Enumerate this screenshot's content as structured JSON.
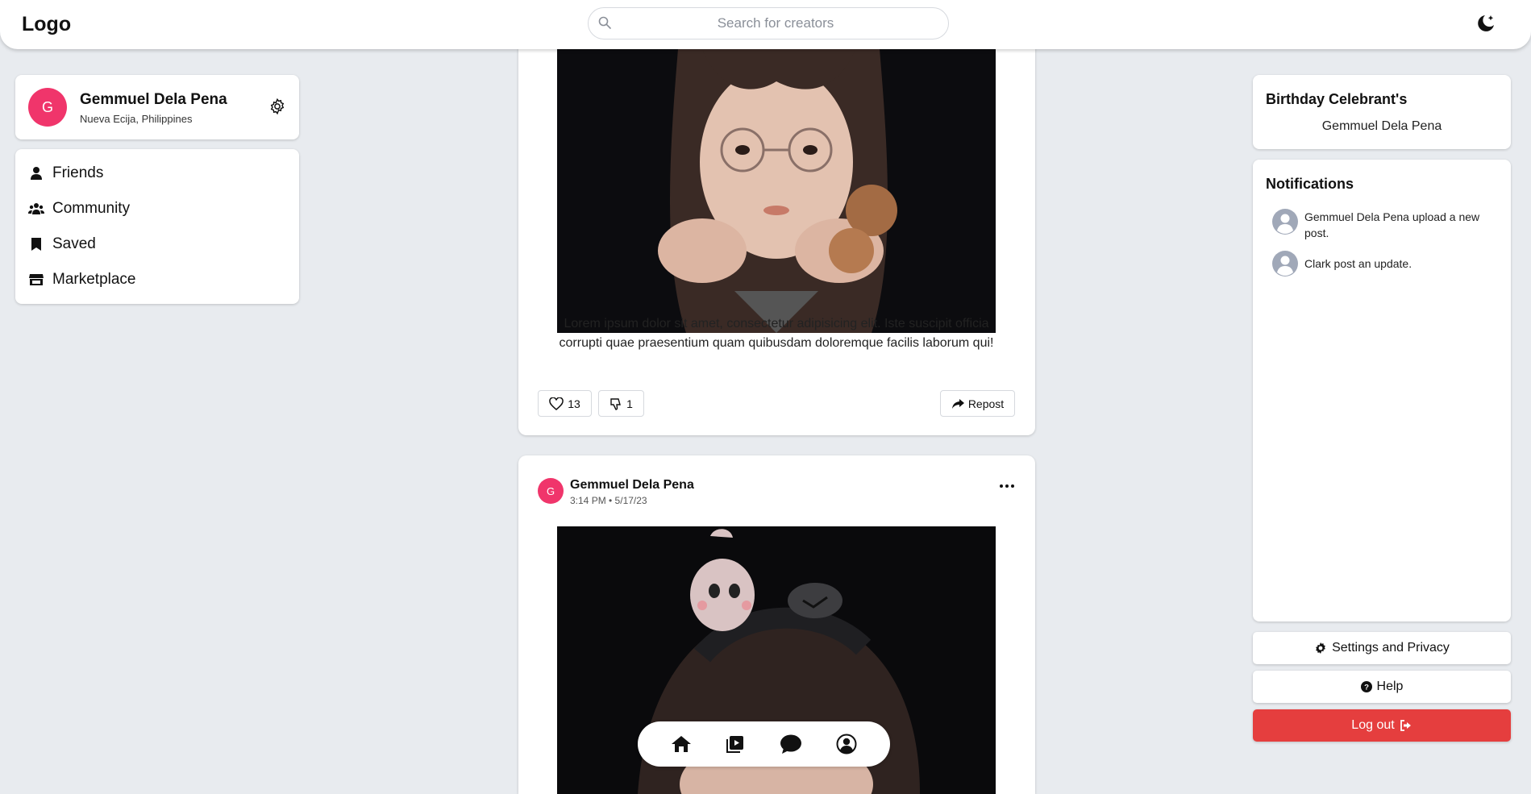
{
  "header": {
    "logo": "Logo",
    "search_placeholder": "Search for creators",
    "icons": {
      "search": "search-icon",
      "theme": "moon-icon"
    }
  },
  "profile": {
    "initial": "G",
    "name": "Gemmuel Dela Pena",
    "location": "Nueva Ecija, Philippines",
    "avatar_color": "#f0356b"
  },
  "sidebar": {
    "items": [
      {
        "label": "Friends",
        "icon": "user-icon"
      },
      {
        "label": "Community",
        "icon": "users-icon"
      },
      {
        "label": "Saved",
        "icon": "bookmark-icon"
      },
      {
        "label": "Marketplace",
        "icon": "store-icon"
      }
    ]
  },
  "feed": {
    "post1": {
      "caption": "Lorem ipsum dolor sit amet, consectetur adipisicing elit. Iste suscipit officia corrupti quae praesentium quam quibusdam doloremque facilis laborum qui!",
      "likes": "13",
      "dislikes": "1",
      "repost_label": "Repost"
    },
    "post2": {
      "initial": "G",
      "author": "Gemmuel Dela Pena",
      "meta": "3:14 PM • 5/17/23"
    }
  },
  "birthday": {
    "title": "Birthday Celebrant's",
    "name": "Gemmuel Dela Pena"
  },
  "notifications": {
    "title": "Notifications",
    "items": [
      {
        "text": "Gemmuel Dela Pena upload a new post."
      },
      {
        "text": "Clark post an update."
      }
    ]
  },
  "actions": {
    "settings": "Settings and Privacy",
    "help": "Help",
    "logout": "Log out"
  },
  "bottom_nav": [
    "home-icon",
    "video-icon",
    "chat-icon",
    "profile-icon"
  ],
  "colors": {
    "accent": "#f0356b",
    "danger": "#e53e3e",
    "background": "#e8ebef"
  }
}
